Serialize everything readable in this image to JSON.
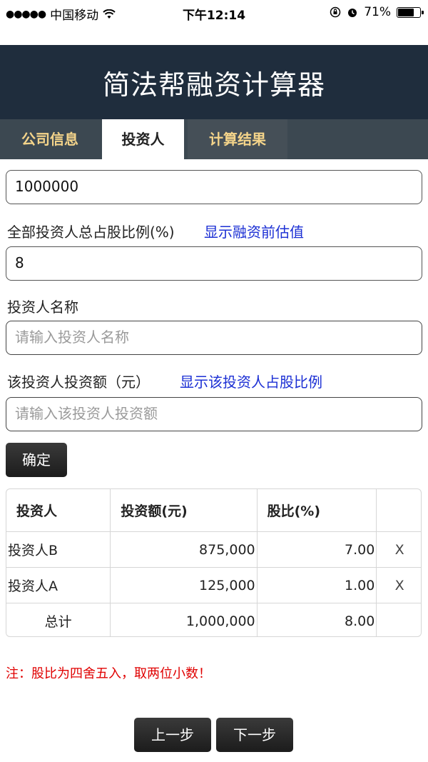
{
  "status_bar": {
    "signal_dots": "●●●●●",
    "carrier": "中国移动",
    "time": "下午12:14",
    "battery": "71%"
  },
  "header": {
    "title": "简法帮融资计算器"
  },
  "tabs": [
    {
      "label": "公司信息"
    },
    {
      "label": "投资人"
    },
    {
      "label": "计算结果"
    }
  ],
  "form": {
    "amount_value": "1000000",
    "total_ratio_label": "全部投资人总占股比例(%)",
    "show_pre_valuation_link": "显示融资前估值",
    "total_ratio_value": "8",
    "investor_name_label": "投资人名称",
    "investor_name_placeholder": "请输入投资人名称",
    "investor_amount_label": "该投资人投资额（元）",
    "show_ratio_link": "显示该投资人占股比例",
    "investor_amount_placeholder": "请输入该投资人投资额",
    "confirm_label": "确定"
  },
  "table": {
    "headers": [
      "投资人",
      "投资额(元)",
      "股比(%)",
      ""
    ],
    "rows": [
      {
        "name": "投资人B",
        "amount": "875,000",
        "ratio": "7.00",
        "delete": "X"
      },
      {
        "name": "投资人A",
        "amount": "125,000",
        "ratio": "1.00",
        "delete": "X"
      }
    ],
    "total": {
      "label": "总计",
      "amount": "1,000,000",
      "ratio": "8.00"
    }
  },
  "note": "注：股比为四舍五入，取两位小数！",
  "nav": {
    "prev_label": "上一步",
    "next_label": "下一步"
  }
}
